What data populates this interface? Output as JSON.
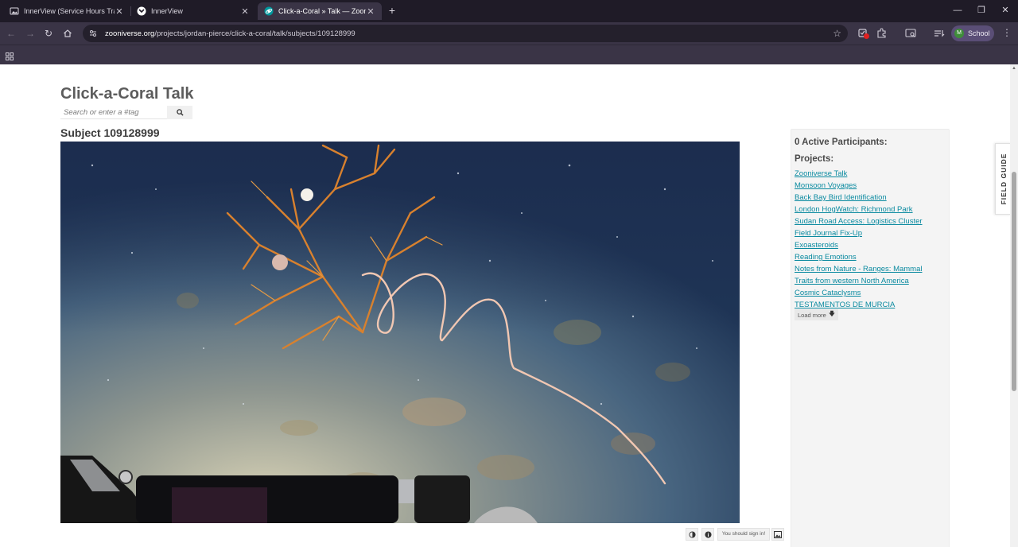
{
  "browser": {
    "tabs": [
      {
        "title": "InnerView (Service Hours Tracke",
        "active": false
      },
      {
        "title": "InnerView",
        "active": false
      },
      {
        "title": "Click-a-Coral » Talk — Zooniver",
        "active": true
      }
    ],
    "url_host": "zooniverse.org",
    "url_path": "/projects/jordan-pierce/click-a-coral/talk/subjects/109128999",
    "profile": {
      "initial": "M",
      "name": "School"
    }
  },
  "talk": {
    "title": "Click-a-Coral Talk",
    "search_placeholder": "Search or enter a #tag"
  },
  "subject": {
    "heading": "Subject 109128999",
    "signin_note": "You should sign in!"
  },
  "sidebar": {
    "active_participants": "0 Active Participants:",
    "projects_heading": "Projects:",
    "projects": [
      "Zooniverse Talk",
      "Monsoon Voyages",
      "Back Bay Bird Identification",
      "London HogWatch: Richmond Park",
      "Sudan Road Access: Logistics Cluster",
      "Field Journal Fix-Up",
      "Exoasteroids",
      "Reading Emotions",
      "Notes from Nature - Ranges: Mammal",
      "Traits from western North America",
      "Cosmic Cataclysms",
      "TESTAMENTOS DE MURCIA"
    ],
    "load_more": "Load more"
  },
  "field_guide": "FIELD GUIDE",
  "colors": {
    "link": "#0a8aa0",
    "chrome_dark": "#1f1b27",
    "chrome": "#3a3446",
    "notification_badge": "#e02020"
  }
}
